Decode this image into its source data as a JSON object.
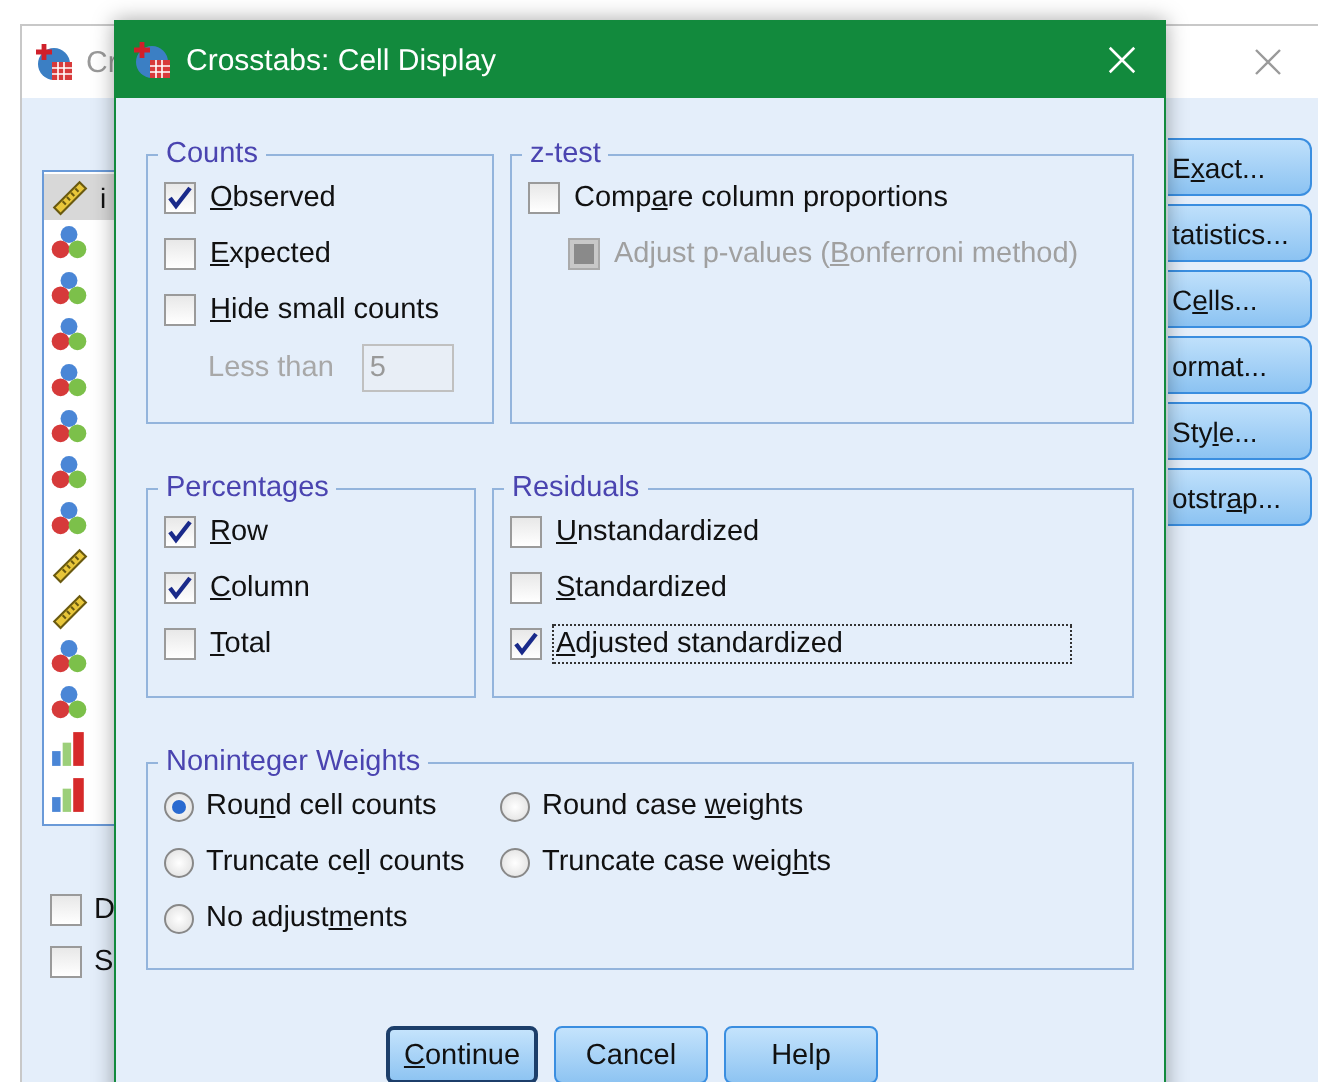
{
  "background_window": {
    "title": "Cr",
    "variables": [
      {
        "kind": "scale",
        "name": "i",
        "selected": true
      },
      {
        "kind": "nominal",
        "selected": false
      },
      {
        "kind": "nominal",
        "selected": false
      },
      {
        "kind": "nominal",
        "selected": false
      },
      {
        "kind": "nominal",
        "selected": false
      },
      {
        "kind": "nominal",
        "selected": false
      },
      {
        "kind": "nominal",
        "selected": false
      },
      {
        "kind": "nominal",
        "selected": false
      },
      {
        "kind": "scale",
        "selected": false
      },
      {
        "kind": "scale",
        "selected": false
      },
      {
        "kind": "nominal",
        "selected": false
      },
      {
        "kind": "nominal",
        "selected": false
      },
      {
        "kind": "ordinal",
        "selected": false
      },
      {
        "kind": "ordinal",
        "selected": false
      }
    ],
    "side_buttons": [
      {
        "pre": "E",
        "key": "x",
        "post": "act..."
      },
      {
        "pre": "tatistics..."
      },
      {
        "pre": "C",
        "key": "e",
        "post": "lls..."
      },
      {
        "post": "ormat..."
      },
      {
        "pre": "Sty",
        "key": "l",
        "post": "e..."
      },
      {
        "pre": "otstr",
        "key": "a",
        "post": "p..."
      }
    ],
    "checkboxes": [
      {
        "label": "D",
        "checked": false
      },
      {
        "label": "S",
        "checked": false
      }
    ]
  },
  "dialog": {
    "title": "Crosstabs: Cell Display",
    "counts": {
      "title": "Counts",
      "options": [
        {
          "label": {
            "key": "O",
            "post": "bserved"
          },
          "checked": true
        },
        {
          "label": {
            "key": "E",
            "post": "xpected"
          },
          "checked": false
        },
        {
          "label": {
            "key": "H",
            "post": "ide small counts"
          },
          "checked": false
        }
      ],
      "less_than": {
        "label": "Less than",
        "value": "5",
        "disabled": true
      }
    },
    "z_test": {
      "title": "z-test",
      "options": [
        {
          "label": {
            "pre": "Comp",
            "key": "a",
            "post": "re column proportions"
          },
          "checked": false,
          "disabled": false
        },
        {
          "label": {
            "pre": "Adjust p-values (",
            "key": "B",
            "post": "onferroni method)"
          },
          "checked": false,
          "disabled": true
        }
      ]
    },
    "percentages": {
      "title": "Percentages",
      "options": [
        {
          "label": {
            "key": "R",
            "post": "ow"
          },
          "checked": true
        },
        {
          "label": {
            "key": "C",
            "post": "olumn"
          },
          "checked": true
        },
        {
          "label": {
            "key": "T",
            "post": "otal"
          },
          "checked": false
        }
      ]
    },
    "residuals": {
      "title": "Residuals",
      "options": [
        {
          "label": {
            "key": "U",
            "post": "nstandardized"
          },
          "checked": false,
          "focused": false
        },
        {
          "label": {
            "key": "S",
            "post": "tandardized"
          },
          "checked": false,
          "focused": false
        },
        {
          "label": {
            "key": "A",
            "post": "djusted standardized"
          },
          "checked": true,
          "focused": true
        }
      ]
    },
    "noninteger_weights": {
      "title": "Noninteger Weights",
      "options": [
        {
          "label": {
            "pre": "Rou",
            "key": "n",
            "post": "d cell counts"
          },
          "selected": true
        },
        {
          "label": {
            "pre": "Round case ",
            "key": "w",
            "post": "eights"
          },
          "selected": false
        },
        {
          "label": {
            "pre": "Truncate ce",
            "key": "l",
            "post": "l counts"
          },
          "selected": false
        },
        {
          "label": {
            "pre": "Truncate case weig",
            "key": "h",
            "post": "ts"
          },
          "selected": false
        },
        {
          "label": {
            "pre": "No adjust",
            "key": "m",
            "post": "ents"
          },
          "selected": false
        }
      ]
    },
    "buttons": [
      {
        "label": {
          "key": "C",
          "post": "ontinue"
        },
        "default": true
      },
      {
        "label": {
          "pre": "Cancel"
        },
        "default": false
      },
      {
        "label": {
          "pre": "Help"
        },
        "default": false
      }
    ]
  }
}
